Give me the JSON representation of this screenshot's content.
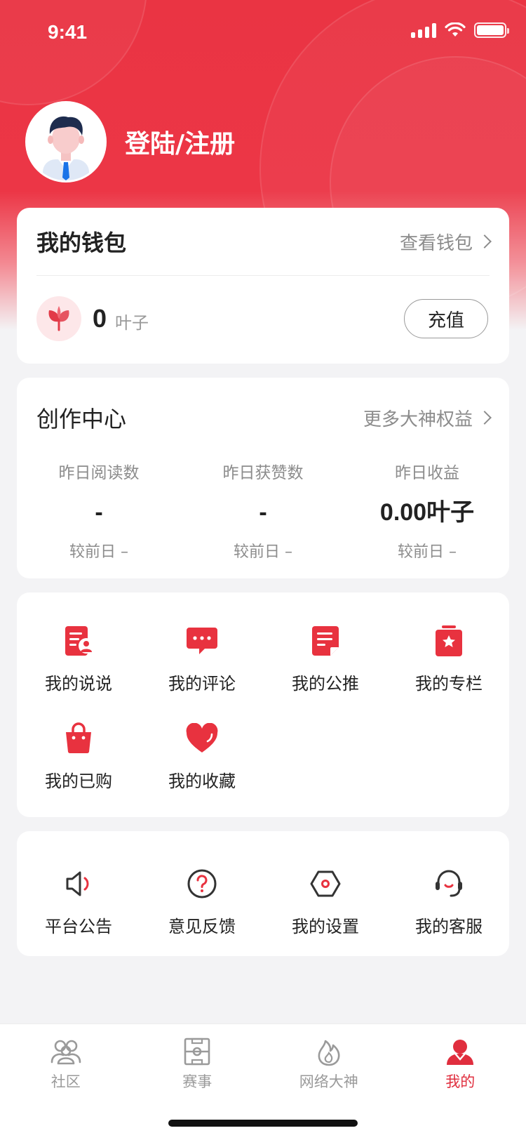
{
  "status_bar": {
    "time": "9:41"
  },
  "profile": {
    "login_label": "登陆/注册"
  },
  "wallet": {
    "title": "我的钱包",
    "view_link": "查看钱包",
    "balance": "0",
    "unit": "叶子",
    "recharge_label": "充值"
  },
  "creator": {
    "title": "创作中心",
    "more_link": "更多大神权益",
    "stats": [
      {
        "label": "昨日阅读数",
        "value": "-",
        "compare": "较前日 –"
      },
      {
        "label": "昨日获赞数",
        "value": "-",
        "compare": "较前日 –"
      },
      {
        "label": "昨日收益",
        "value": "0.00叶子",
        "compare": "较前日 –"
      }
    ]
  },
  "my_items": [
    {
      "label": "我的说说",
      "icon": "posts-icon"
    },
    {
      "label": "我的评论",
      "icon": "comment-icon"
    },
    {
      "label": "我的公推",
      "icon": "recommend-icon"
    },
    {
      "label": "我的专栏",
      "icon": "column-icon"
    },
    {
      "label": "我的已购",
      "icon": "shopping-bag-icon"
    },
    {
      "label": "我的收藏",
      "icon": "heart-icon"
    }
  ],
  "tools": [
    {
      "label": "平台公告",
      "icon": "speaker-icon"
    },
    {
      "label": "意见反馈",
      "icon": "question-icon"
    },
    {
      "label": "我的设置",
      "icon": "settings-icon"
    },
    {
      "label": "我的客服",
      "icon": "headset-icon"
    }
  ],
  "tabbar": {
    "tabs": [
      {
        "label": "社区",
        "icon": "community-icon"
      },
      {
        "label": "赛事",
        "icon": "field-icon"
      },
      {
        "label": "网络大神",
        "icon": "flame-icon"
      },
      {
        "label": "我的",
        "icon": "user-icon",
        "active": true
      }
    ]
  },
  "colors": {
    "brand": "#ea3443",
    "tab_active": "#e02e3e"
  }
}
